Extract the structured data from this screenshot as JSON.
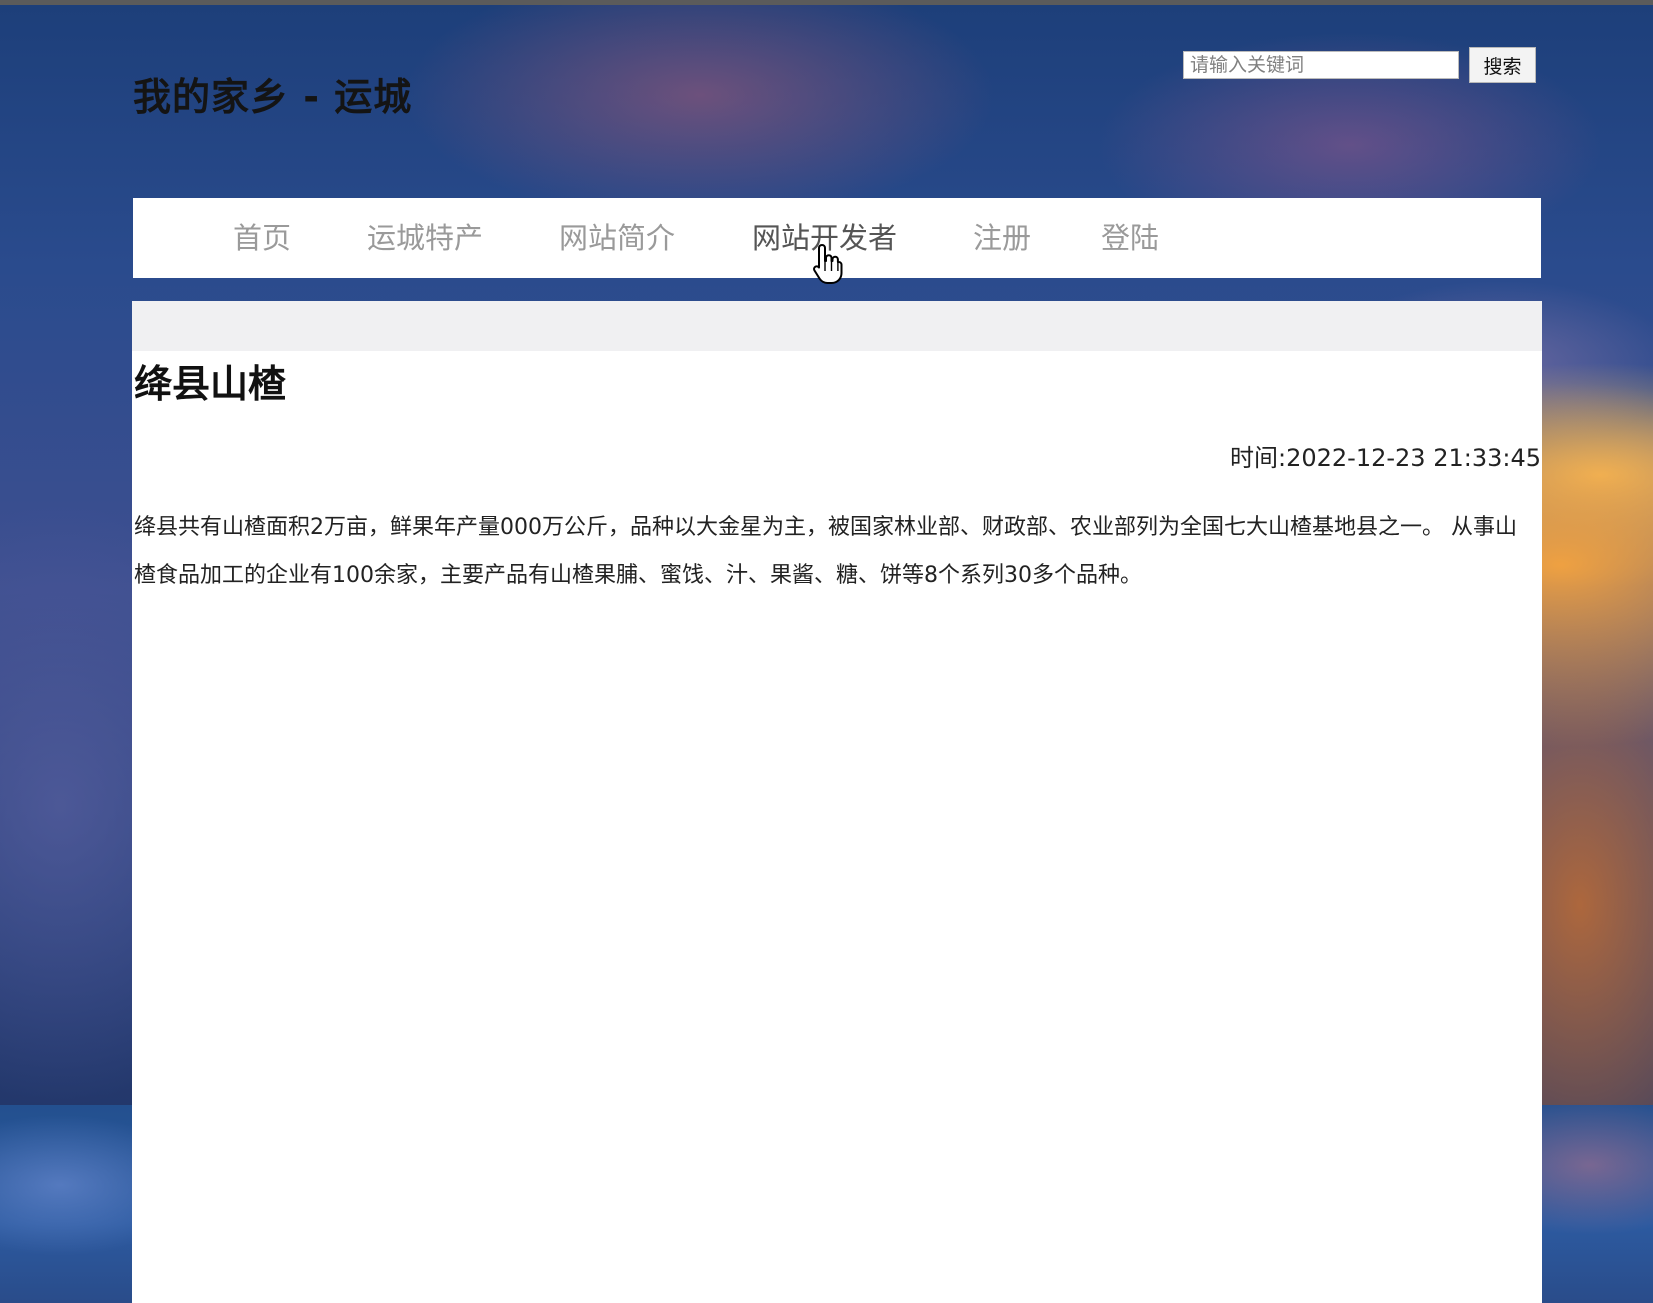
{
  "header": {
    "site_title": "我的家乡 - 运城"
  },
  "search": {
    "placeholder": "请输入关键词",
    "button_label": "搜索"
  },
  "nav": {
    "items": [
      {
        "label": "首页"
      },
      {
        "label": "运城特产"
      },
      {
        "label": "网站简介"
      },
      {
        "label": "网站开发者"
      },
      {
        "label": "注册"
      },
      {
        "label": "登陆"
      }
    ],
    "hovered_index": 3
  },
  "article": {
    "title": "绛县山楂",
    "timestamp": "时间:2022-12-23 21:33:45",
    "body": "绛县共有山楂面积2万亩，鲜果年产量000万公斤，品种以大金星为主，被国家林业部、财政部、农业部列为全国七大山楂基地县之一。 从事山楂食品加工的企业有100余家，主要产品有山楂果脯、蜜饯、汁、果酱、糖、饼等8个系列30多个品种。"
  },
  "icons": {
    "cursor": "hand-pointer-icon"
  }
}
